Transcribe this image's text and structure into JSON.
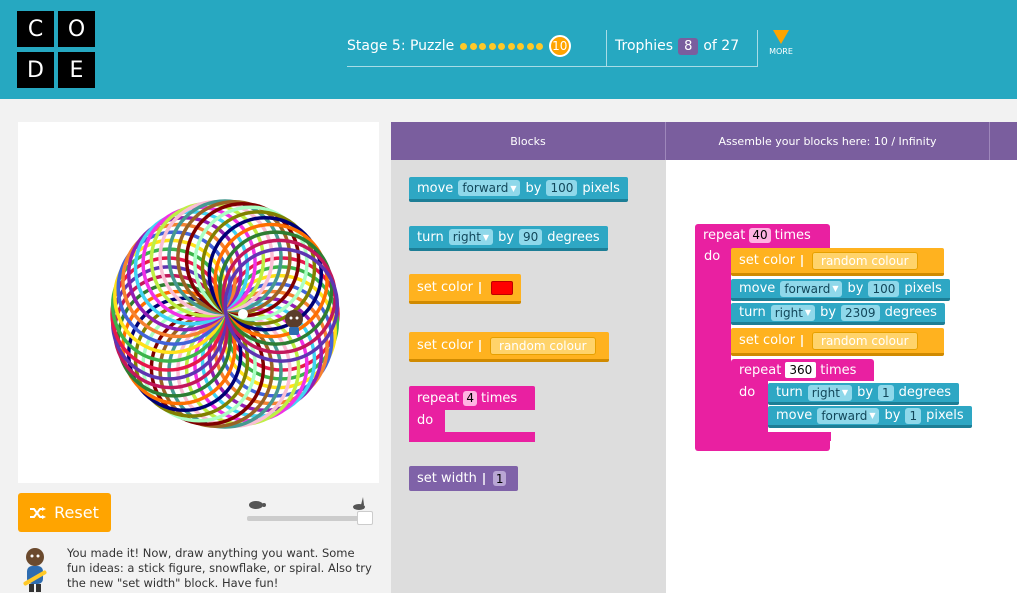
{
  "logo": {
    "letters": [
      "C",
      "O",
      "D",
      "E"
    ]
  },
  "header": {
    "stage_label": "Stage 5: Puzzle",
    "progress_dots": 9,
    "current_puzzle": "10",
    "trophies_label": "Trophies",
    "trophies_earned": "8",
    "trophies_total": "of 27",
    "more_label": "MORE"
  },
  "canvas": {
    "description": "spirograph"
  },
  "controls": {
    "reset_label": "Reset",
    "speed_slow_icon": "turtle-icon",
    "speed_fast_icon": "rabbit-icon"
  },
  "instructions": {
    "text": "You made it! Now, draw anything you want. Some fun ideas: a stick figure, snowflake, or spiral. Also try the new \"set width\" block. Have fun!"
  },
  "tabs": {
    "blocks": "Blocks",
    "workspace": "Assemble your blocks here: 10 / Infinity"
  },
  "toolbox": {
    "move": {
      "verb": "move",
      "dir": "forward",
      "by": "by",
      "value": "100",
      "unit": "pixels"
    },
    "turn": {
      "verb": "turn",
      "dir": "right",
      "by": "by",
      "value": "90",
      "unit": "degrees"
    },
    "set_color_swatch": {
      "label": "set color",
      "color": "#ff0000"
    },
    "set_color_random": {
      "label": "set color",
      "value": "random colour"
    },
    "repeat": {
      "label": "repeat",
      "value": "4",
      "times": "times",
      "do": "do"
    },
    "set_width": {
      "label": "set width",
      "value": "1"
    }
  },
  "program": {
    "repeat_outer": {
      "label": "repeat",
      "value": "40",
      "times": "times",
      "do": "do"
    },
    "set_color_1": {
      "label": "set color",
      "value": "random colour"
    },
    "move_1": {
      "verb": "move",
      "dir": "forward",
      "by": "by",
      "value": "100",
      "unit": "pixels"
    },
    "turn_1": {
      "verb": "turn",
      "dir": "right",
      "by": "by",
      "value": "2309",
      "unit": "degrees"
    },
    "set_color_2": {
      "label": "set color",
      "value": "random colour"
    },
    "repeat_inner": {
      "label": "repeat",
      "value": "360",
      "times": "times",
      "do": "do"
    },
    "turn_2": {
      "verb": "turn",
      "dir": "right",
      "by": "by",
      "value": "1",
      "unit": "degrees"
    },
    "move_2": {
      "verb": "move",
      "dir": "forward",
      "by": "by",
      "value": "1",
      "unit": "pixels"
    }
  },
  "colors": {
    "header_bg": "#26a8c1",
    "tab_purple": "#7a5e9e",
    "accent_orange": "#ffa400",
    "block_cyan": "#2ea7c4",
    "block_yellow": "#ffb21f",
    "block_pink": "#e920a1",
    "block_purple": "#7f62a8"
  }
}
